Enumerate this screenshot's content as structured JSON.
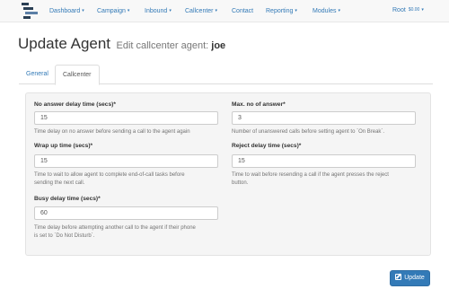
{
  "nav": {
    "items": [
      {
        "label": "Dashboard",
        "caret": "▾"
      },
      {
        "label": "Campaign",
        "caret": "▾"
      },
      {
        "label": "Inbound",
        "caret": "▾"
      },
      {
        "label": "Callcenter",
        "caret": "▾"
      },
      {
        "label": "Contact",
        "caret": ""
      },
      {
        "label": "Reporting",
        "caret": "▾"
      },
      {
        "label": "Modules",
        "caret": "▾"
      }
    ],
    "user": {
      "name": "Root",
      "balance": "$0.00",
      "caret": "▾"
    }
  },
  "page": {
    "title": "Update Agent",
    "subtitle_prefix": "Edit callcenter agent:",
    "agent_name": "joe"
  },
  "tabs": [
    {
      "label": "General"
    },
    {
      "label": "Callcenter"
    }
  ],
  "form": {
    "no_answer_delay": {
      "label": "No answer delay time (secs)*",
      "value": "15",
      "help": "Time delay on no answer before sending a call to the agent again"
    },
    "max_no_answer": {
      "label": "Max. no of answer*",
      "value": "3",
      "help": "Number of unanswered calls before setting agent to `On Break`."
    },
    "wrap_up_time": {
      "label": "Wrap up time (secs)*",
      "value": "15",
      "help_line1": "Time to wait to allow agent to complete end-of-call tasks before",
      "help_line2": "sending the next call."
    },
    "reject_delay": {
      "label": "Reject delay time (secs)*",
      "value": "15",
      "help_line1": "Time to wait before resending a call if the agent presses the reject",
      "help_line2": "button."
    },
    "busy_delay": {
      "label": "Busy delay time (secs)*",
      "value": "60",
      "help_line1": "Time delay before attempting another call to the agent if their phone",
      "help_line2": "is set to `Do Not Disturb`."
    }
  },
  "update_button": {
    "label": "Update"
  },
  "colors": {
    "primary": "#337ab7",
    "navbar_bg": "#f8f8f8",
    "panel_bg": "#f5f5f5"
  }
}
